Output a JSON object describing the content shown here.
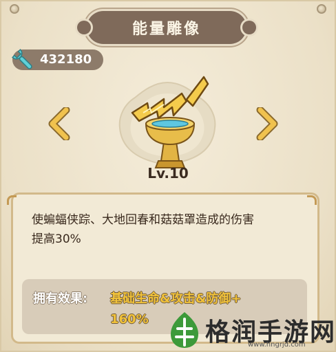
{
  "header": {
    "title": "能量雕像"
  },
  "currency": {
    "icon": "wrench-icon",
    "value": "432180"
  },
  "statue": {
    "icon": "lightning-statue-icon",
    "level": "Lv.10"
  },
  "navigation": {
    "prev_icon": "chevron-left-icon",
    "next_icon": "chevron-right-icon"
  },
  "description": {
    "line1": "使蝙蝠侠踪、大地回春和菇菇罩造成的伤害",
    "line2": "提高30%"
  },
  "effect": {
    "label": "拥有效果:",
    "value_line1": "基础生命&攻击&防御+",
    "value_line2": "160%"
  },
  "watermark": {
    "text": "格润手游网",
    "url": "www.hngrjd.com"
  },
  "colors": {
    "background": "#ece2cc",
    "title_plaque": "#7f6a5a",
    "accent_gold": "#f1c23a",
    "arrow": "#e7b944",
    "text_dark": "#3a2a1e"
  }
}
